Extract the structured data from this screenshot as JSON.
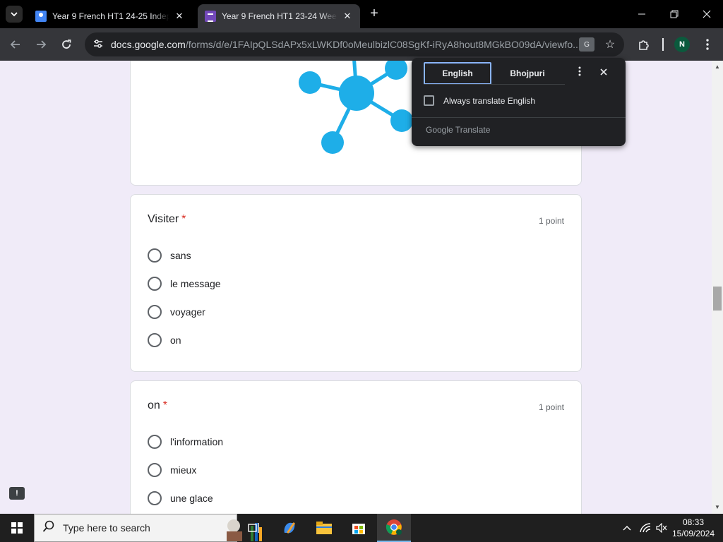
{
  "browser": {
    "tabs": [
      {
        "title": "Year 9 French HT1 24-25 Independent",
        "favicon": "google-classroom-icon",
        "active": false
      },
      {
        "title": "Year 9 French HT1 23-24 Week 1",
        "favicon": "google-forms-icon",
        "active": true
      }
    ],
    "url_host": "docs.google.com",
    "url_path": "/forms/d/e/1FAIpQLSdAPx5xLWKDf0oMeulbizlC08SgKf-iRyA8hout8MGkBO09dA/viewfo...",
    "profile_initial": "N"
  },
  "translate_popup": {
    "source_language": "English",
    "target_language": "Bhojpuri",
    "always_translate_label": "Always translate English",
    "footer_brand": "Google",
    "footer_product": "Translate"
  },
  "questions": [
    {
      "title": "Visiter",
      "required_mark": "*",
      "points": "1 point",
      "options": [
        "sans",
        "le message",
        "voyager",
        "on"
      ]
    },
    {
      "title": "on",
      "required_mark": "*",
      "points": "1 point",
      "options": [
        "l'information",
        "mieux",
        "une glace"
      ]
    }
  ],
  "taskbar": {
    "search_placeholder": "Type here to search",
    "time": "08:33",
    "date": "15/09/2024"
  },
  "colors": {
    "page_background": "#f0ebf8",
    "network_graphic": "#1eaee8",
    "required": "#d93025",
    "accent_focus": "#8ab4f8"
  }
}
